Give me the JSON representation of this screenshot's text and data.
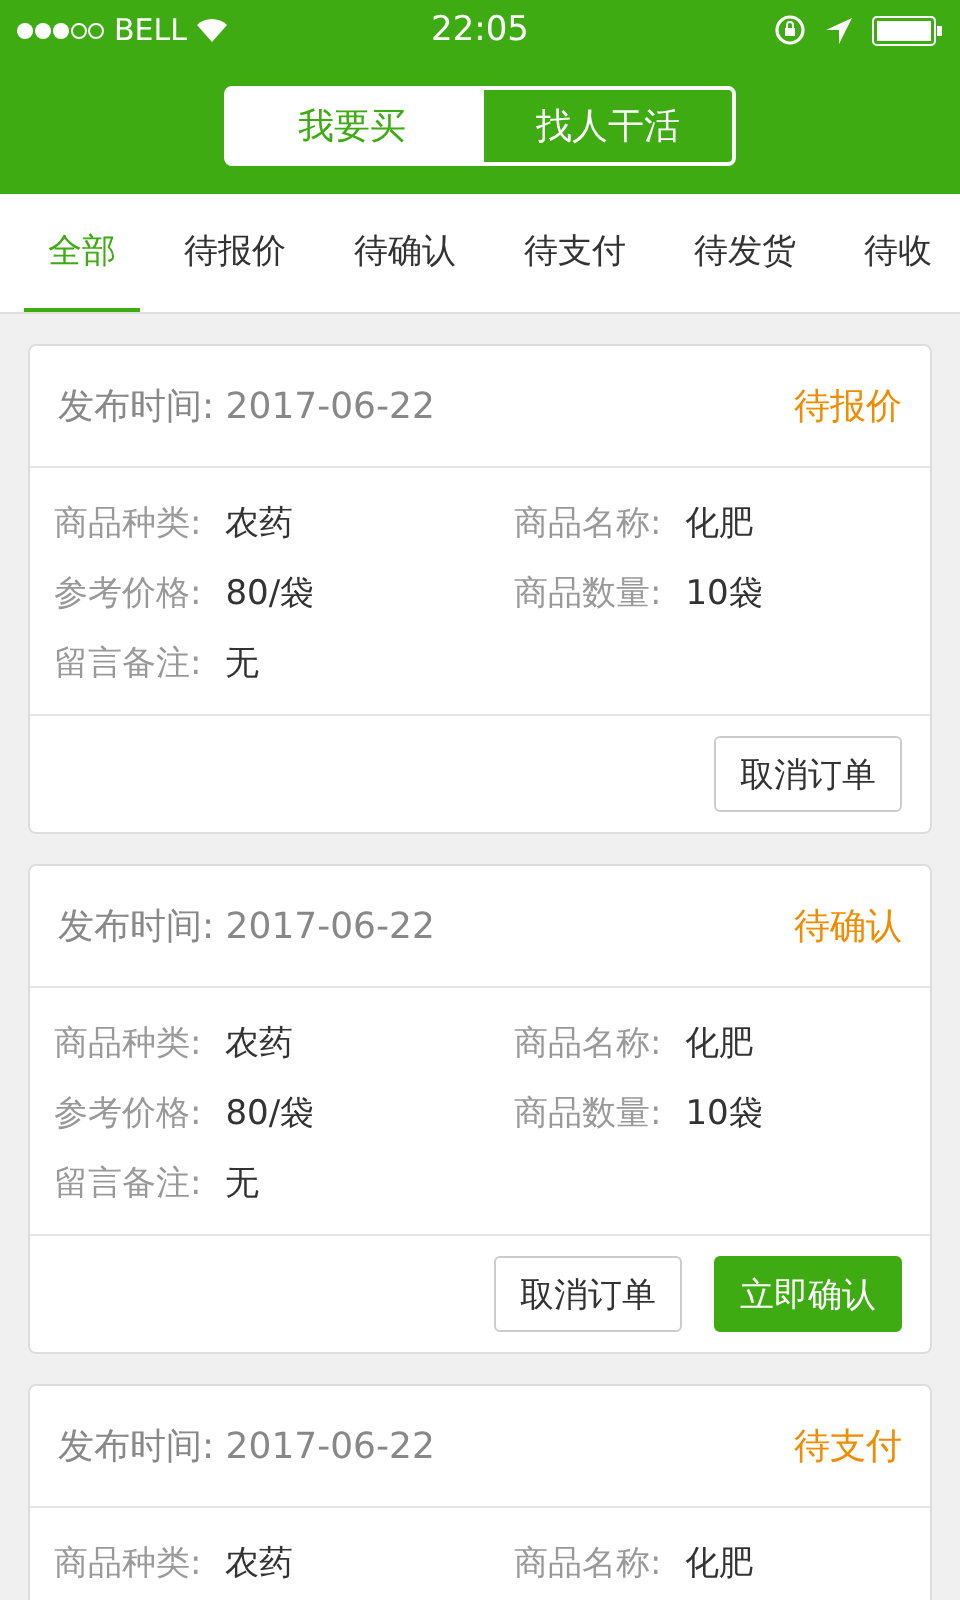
{
  "status_bar": {
    "carrier": "BELL",
    "time": "22:05"
  },
  "segments": [
    {
      "label": "我要买",
      "selected": true
    },
    {
      "label": "找人干活",
      "selected": false
    }
  ],
  "tabs": [
    {
      "label": "全部",
      "selected": true
    },
    {
      "label": "待报价",
      "selected": false
    },
    {
      "label": "待确认",
      "selected": false
    },
    {
      "label": "待支付",
      "selected": false
    },
    {
      "label": "待发货",
      "selected": false
    },
    {
      "label": "待收",
      "selected": false
    }
  ],
  "orders": [
    {
      "date_label": "发布时间:",
      "date": "2017-06-22",
      "status": "待报价",
      "fields": [
        {
          "label": "商品种类:",
          "value": "农药"
        },
        {
          "label": "商品名称:",
          "value": "化肥"
        },
        {
          "label": "参考价格:",
          "value": "80/袋"
        },
        {
          "label": "商品数量:",
          "value": "10袋"
        },
        {
          "label": "留言备注:",
          "value": "无"
        }
      ],
      "buttons": [
        {
          "label": "取消订单",
          "kind": "default"
        }
      ]
    },
    {
      "date_label": "发布时间:",
      "date": "2017-06-22",
      "status": "待确认",
      "fields": [
        {
          "label": "商品种类:",
          "value": "农药"
        },
        {
          "label": "商品名称:",
          "value": "化肥"
        },
        {
          "label": "参考价格:",
          "value": "80/袋"
        },
        {
          "label": "商品数量:",
          "value": "10袋"
        },
        {
          "label": "留言备注:",
          "value": "无"
        }
      ],
      "buttons": [
        {
          "label": "取消订单",
          "kind": "default"
        },
        {
          "label": "立即确认",
          "kind": "primary"
        }
      ]
    },
    {
      "date_label": "发布时间:",
      "date": "2017-06-22",
      "status": "待支付",
      "fields": [
        {
          "label": "商品种类:",
          "value": "农药"
        },
        {
          "label": "商品名称:",
          "value": "化肥"
        }
      ]
    }
  ]
}
